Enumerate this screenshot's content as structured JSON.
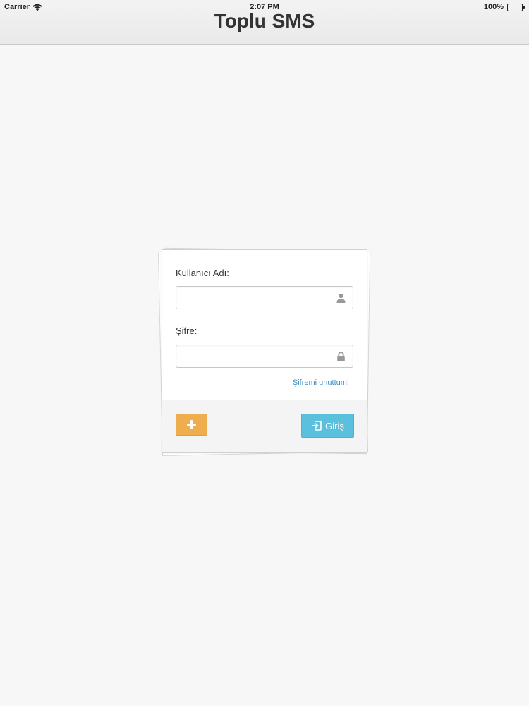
{
  "status_bar": {
    "carrier": "Carrier",
    "time": "2:07 PM",
    "battery": "100%"
  },
  "nav": {
    "title": "Toplu SMS"
  },
  "login": {
    "username_label": "Kullanıcı Adı:",
    "username_value": "",
    "password_label": "Şifre:",
    "password_value": "",
    "forgot_link": "Şifremi unuttum!",
    "add_icon": "plus-icon",
    "login_label": "Giriş",
    "login_icon": "sign-in-icon"
  },
  "colors": {
    "add_button": "#f0ad4e",
    "login_button": "#5bc0de",
    "link": "#3a8fc7"
  }
}
